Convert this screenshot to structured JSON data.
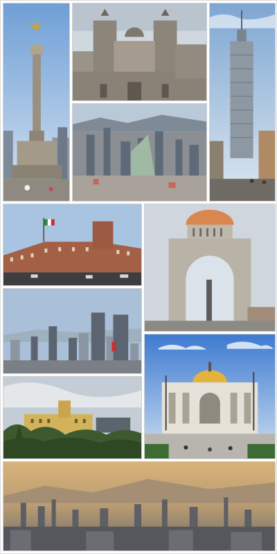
{
  "gallery": {
    "tiles": [
      {
        "name": "angel-of-independence",
        "icon": "column-monument-photo"
      },
      {
        "name": "metropolitan-cathedral",
        "icon": "cathedral-photo"
      },
      {
        "name": "torre-latinoamericana",
        "icon": "skyscraper-photo"
      },
      {
        "name": "city-skyline-aerial",
        "icon": "city-aerial-photo"
      },
      {
        "name": "national-palace",
        "icon": "palace-photo"
      },
      {
        "name": "monument-to-the-revolution",
        "icon": "arch-monument-photo"
      },
      {
        "name": "skyline-towers",
        "icon": "skyline-photo"
      },
      {
        "name": "chapultepec-castle",
        "icon": "castle-photo"
      },
      {
        "name": "palacio-de-bellas-artes",
        "icon": "domed-palace-photo"
      },
      {
        "name": "hazy-city-panorama",
        "icon": "panorama-photo"
      }
    ],
    "colors": {
      "sky_blue": "#8fb6e0",
      "haze_gold": "#c9a56a",
      "foliage_green": "#3c5a2e",
      "stone_grey": "#b9b2a6",
      "dome_orange": "#d9874f"
    }
  }
}
